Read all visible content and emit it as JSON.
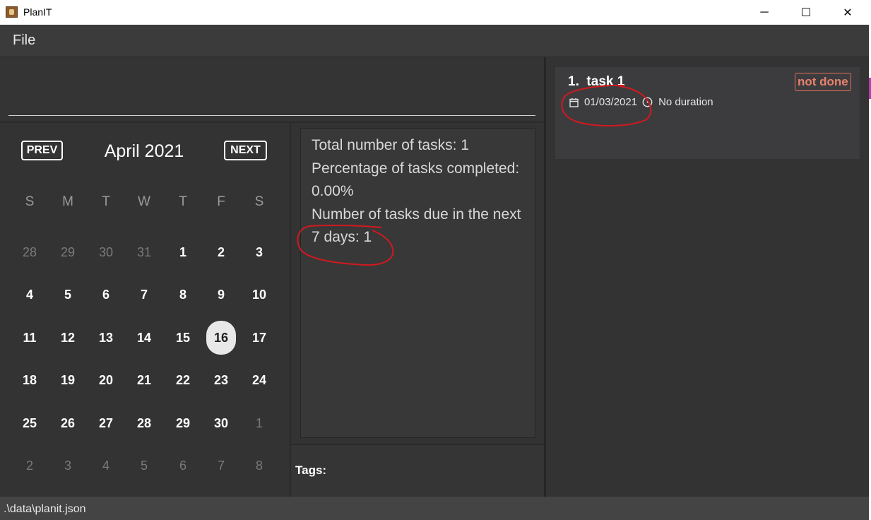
{
  "window": {
    "title": "PlanIT",
    "controls": {
      "minimize": "─",
      "maximize": "☐",
      "close": "✕"
    }
  },
  "menu": {
    "file": "File"
  },
  "command_box": {
    "value": ""
  },
  "calendar": {
    "prev_label": "PREV",
    "next_label": "NEXT",
    "month_label": "April 2021",
    "weekdays": [
      "S",
      "M",
      "T",
      "W",
      "T",
      "F",
      "S"
    ],
    "weeks": [
      [
        "28",
        "29",
        "30",
        "31",
        "1",
        "2",
        "3"
      ],
      [
        "4",
        "5",
        "6",
        "7",
        "8",
        "9",
        "10"
      ],
      [
        "11",
        "12",
        "13",
        "14",
        "15",
        "16",
        "17"
      ],
      [
        "18",
        "19",
        "20",
        "21",
        "22",
        "23",
        "24"
      ],
      [
        "25",
        "26",
        "27",
        "28",
        "29",
        "30",
        "1"
      ],
      [
        "2",
        "3",
        "4",
        "5",
        "6",
        "7",
        "8"
      ]
    ],
    "today": "16"
  },
  "stats": {
    "line1": "Total number of tasks: 1",
    "line2": "Percentage of tasks completed: 0.00%",
    "line3": "Number of tasks due in the next 7 days: 1"
  },
  "tags": {
    "label": "Tags:"
  },
  "tasks": [
    {
      "index": "1.",
      "name": "task 1",
      "status": "not done",
      "date": "01/03/2021",
      "duration": "No duration"
    }
  ],
  "status_bar": {
    "path": ".\\data\\planit.json"
  },
  "colors": {
    "background": "#333333",
    "status_not_done": "#e8826c",
    "annotation": "#d0191f"
  }
}
